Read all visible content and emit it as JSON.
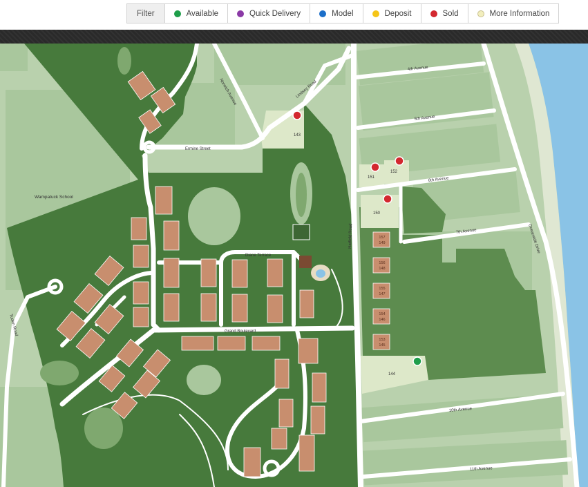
{
  "filter": {
    "label": "Filter",
    "items": [
      {
        "key": "available",
        "label": "Available",
        "color": "#1e9e4a"
      },
      {
        "key": "quick",
        "label": "Quick Delivery",
        "color": "#8b3aa6"
      },
      {
        "key": "model",
        "label": "Model",
        "color": "#1c6fc9"
      },
      {
        "key": "deposit",
        "label": "Deposit",
        "color": "#f5c518"
      },
      {
        "key": "sold",
        "label": "Sold",
        "color": "#d3282f"
      },
      {
        "key": "info",
        "label": "More Information",
        "color": "#f2eebd"
      }
    ]
  },
  "map": {
    "streets": {
      "fourth": "4th Avenue",
      "fifth": "5th Avenue",
      "sixth": "6th Avenue",
      "seventh": "7th Avenue",
      "tenth": "10th Avenue",
      "eleventh": "11th Avenue",
      "ermine": "Ermine Street",
      "harbor": "Hatfield Road",
      "diane": "Diane Terrace",
      "grand": "Grand Boulevard",
      "tuden": "Tuden Road",
      "norwich": "Norwich Avenue",
      "oceanside": "Oceanside Drive",
      "lindsey": "Lindsey Road"
    },
    "school": "Wampatuck School",
    "lots": {
      "l143": "143",
      "l151": "151",
      "l152": "152",
      "l150": "150",
      "l144": "144"
    }
  }
}
